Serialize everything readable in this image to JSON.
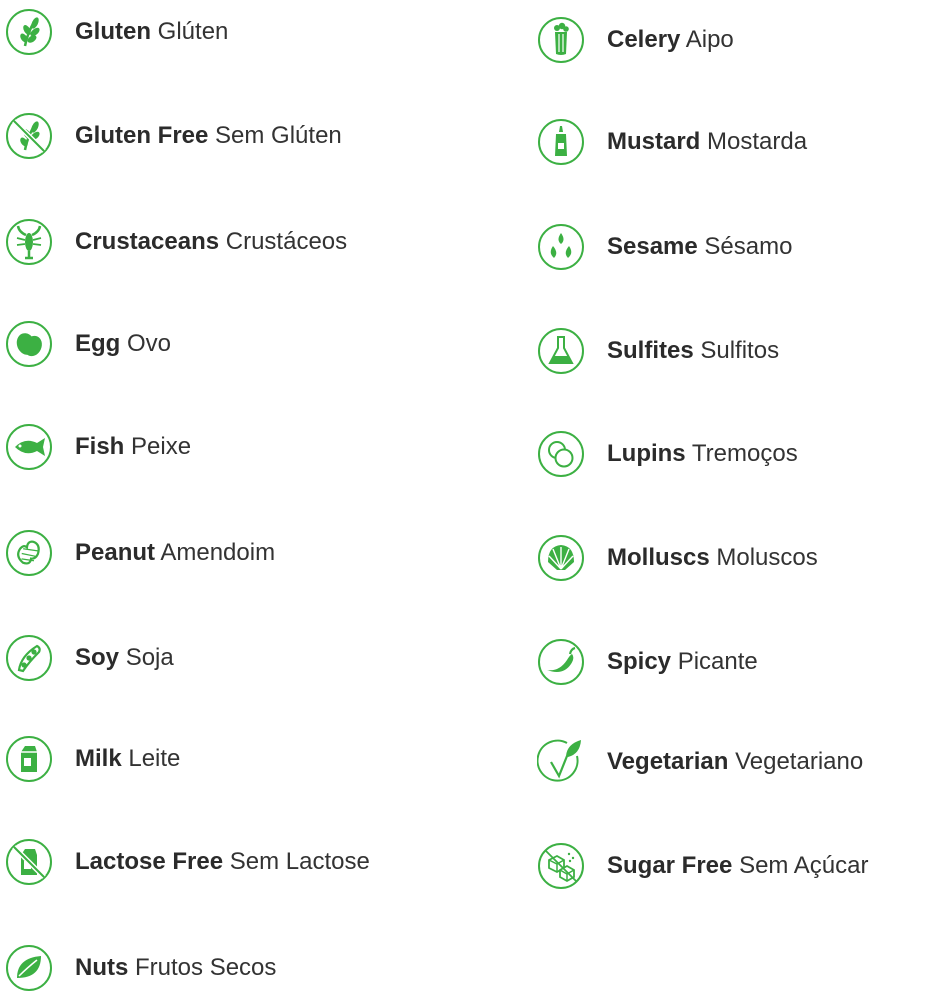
{
  "accent_color": "#3cb043",
  "left_column": [
    {
      "icon": "gluten-icon",
      "name": "Gluten",
      "translation": "Glúten"
    },
    {
      "icon": "gluten-free-icon",
      "name": "Gluten Free",
      "translation": "Sem Glúten"
    },
    {
      "icon": "crustaceans-icon",
      "name": "Crustaceans",
      "translation": "Crustáceos"
    },
    {
      "icon": "egg-icon",
      "name": "Egg",
      "translation": "Ovo"
    },
    {
      "icon": "fish-icon",
      "name": "Fish",
      "translation": "Peixe"
    },
    {
      "icon": "peanut-icon",
      "name": "Peanut",
      "translation": "Amendoim"
    },
    {
      "icon": "soy-icon",
      "name": "Soy",
      "translation": "Soja"
    },
    {
      "icon": "milk-icon",
      "name": "Milk",
      "translation": "Leite"
    },
    {
      "icon": "lactose-free-icon",
      "name": "Lactose Free",
      "translation": "Sem Lactose"
    },
    {
      "icon": "nuts-icon",
      "name": "Nuts",
      "translation": "Frutos Secos"
    }
  ],
  "right_column": [
    {
      "icon": "celery-icon",
      "name": "Celery",
      "translation": "Aipo"
    },
    {
      "icon": "mustard-icon",
      "name": "Mustard",
      "translation": "Mostarda"
    },
    {
      "icon": "sesame-icon",
      "name": "Sesame",
      "translation": "Sésamo"
    },
    {
      "icon": "sulfites-icon",
      "name": "Sulfites",
      "translation": "Sulfitos"
    },
    {
      "icon": "lupins-icon",
      "name": "Lupins",
      "translation": "Tremoços"
    },
    {
      "icon": "molluscs-icon",
      "name": "Molluscs",
      "translation": "Moluscos"
    },
    {
      "icon": "spicy-icon",
      "name": "Spicy",
      "translation": "Picante"
    },
    {
      "icon": "vegetarian-icon",
      "name": "Vegetarian",
      "translation": "Vegetariano"
    },
    {
      "icon": "sugar-free-icon",
      "name": "Sugar Free",
      "translation": "Sem Açúcar"
    }
  ]
}
